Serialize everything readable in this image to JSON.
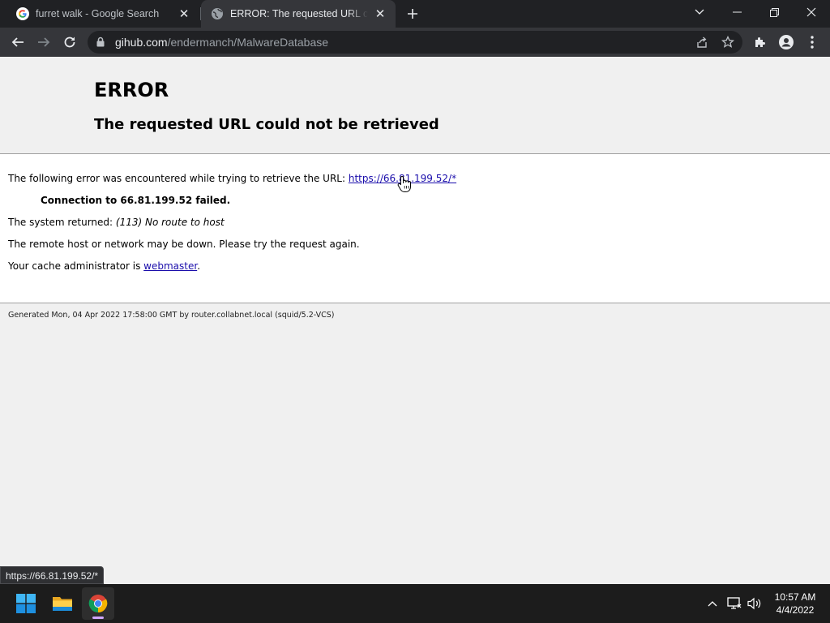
{
  "tabs": [
    {
      "title": "furret walk - Google Search",
      "favicon": "google-g-icon",
      "active": false
    },
    {
      "title": "ERROR: The requested URL could not be retrieved",
      "favicon": "globe-icon",
      "active": true
    }
  ],
  "address_bar": {
    "host": "gihub.com",
    "path": "/endermanch/MalwareDatabase"
  },
  "page": {
    "error_title": "ERROR",
    "error_subtitle": "The requested URL could not be retrieved",
    "intro_text": "The following error was encountered while trying to retrieve the URL:",
    "url_link": "https://66.81.199.52/*",
    "connection_failed": "Connection to 66.81.199.52 failed.",
    "system_returned_label": "The system returned:",
    "system_returned_value": "(113) No route to host",
    "remote_host_text": "The remote host or network may be down. Please try the request again.",
    "cache_admin_text": "Your cache administrator is",
    "webmaster_link": "webmaster",
    "cache_admin_suffix": ".",
    "footer": "Generated Mon, 04 Apr 2022 17:58:00 GMT by router.collabnet.local (squid/5.2-VCS)"
  },
  "status_bubble": "https://66.81.199.52/*",
  "taskbar": {
    "apps": [
      "start-icon",
      "file-explorer-icon",
      "chrome-icon"
    ],
    "clock_time": "10:57 AM",
    "clock_date": "4/4/2022"
  },
  "colors": {
    "link": "#1a0dab",
    "chrome_dark": "#202124",
    "toolbar": "#35363a",
    "taskbar": "#1c1c1c"
  }
}
